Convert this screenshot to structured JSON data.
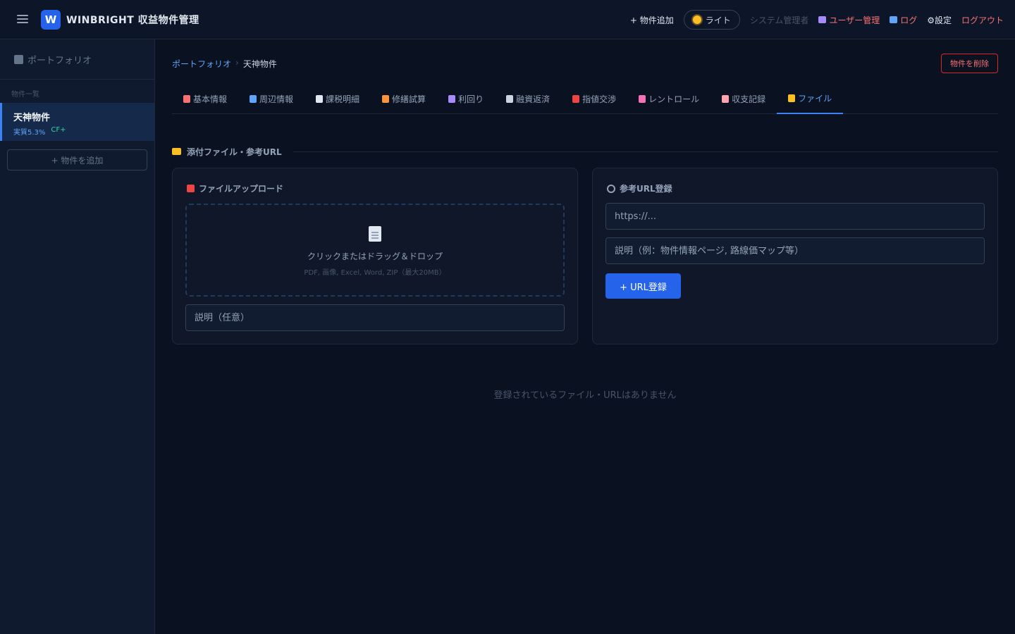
{
  "header": {
    "logo_letter": "W",
    "app_title": "WINBRIGHT 収益物件管理",
    "add_property": "+ 物件追加",
    "theme_toggle": "ライト",
    "role": "システム管理者",
    "user_mgmt": "ユーザー管理",
    "log": "ログ",
    "settings": "⚙設定",
    "logout": "ログアウト"
  },
  "sidebar": {
    "portfolio": "ポートフォリオ",
    "section_label": "物件一覧",
    "properties": [
      {
        "name": "天神物件",
        "yield": "実質5.3%",
        "cf": "CF+"
      }
    ],
    "add_button": "+ 物件を追加"
  },
  "breadcrumb": {
    "root": "ポートフォリオ",
    "separator": "›",
    "current": "天神物件"
  },
  "delete_button": "物件を削除",
  "tabs": [
    {
      "label": "基本情報",
      "icon": "clipboard-icon",
      "color": "#f87171"
    },
    {
      "label": "周辺情報",
      "icon": "map-icon",
      "color": "#60a5fa"
    },
    {
      "label": "課税明細",
      "icon": "receipt-icon",
      "color": "#e2e8f0"
    },
    {
      "label": "修繕試算",
      "icon": "hammer-icon",
      "color": "#fb923c"
    },
    {
      "label": "利回り",
      "icon": "chart-icon",
      "color": "#a78bfa"
    },
    {
      "label": "融資返済",
      "icon": "bank-icon",
      "color": "#cbd5e1"
    },
    {
      "label": "指値交渉",
      "icon": "target-icon",
      "color": "#ef4444"
    },
    {
      "label": "レントロール",
      "icon": "house-icon",
      "color": "#f472b6"
    },
    {
      "label": "収支記録",
      "icon": "document-icon",
      "color": "#fda4af"
    },
    {
      "label": "ファイル",
      "icon": "folder-icon",
      "color": "#fbbf24",
      "active": true
    }
  ],
  "section": {
    "title": "添付ファイル・参考URL"
  },
  "upload_card": {
    "title": "ファイルアップロード",
    "drop_main": "クリックまたはドラッグ＆ドロップ",
    "drop_sub": "PDF, 画像, Excel, Word, ZIP（最大20MB）",
    "description_placeholder": "説明（任意）"
  },
  "url_card": {
    "title": "参考URL登録",
    "url_placeholder": "https://...",
    "description_placeholder": "説明（例：物件情報ページ, 路線価マップ等）",
    "submit_label": "+ URL登録"
  },
  "empty_message": "登録されているファイル・URLはありません",
  "colors": {
    "accent": "#2563eb",
    "danger": "#f87171",
    "background": "#0a1120"
  }
}
